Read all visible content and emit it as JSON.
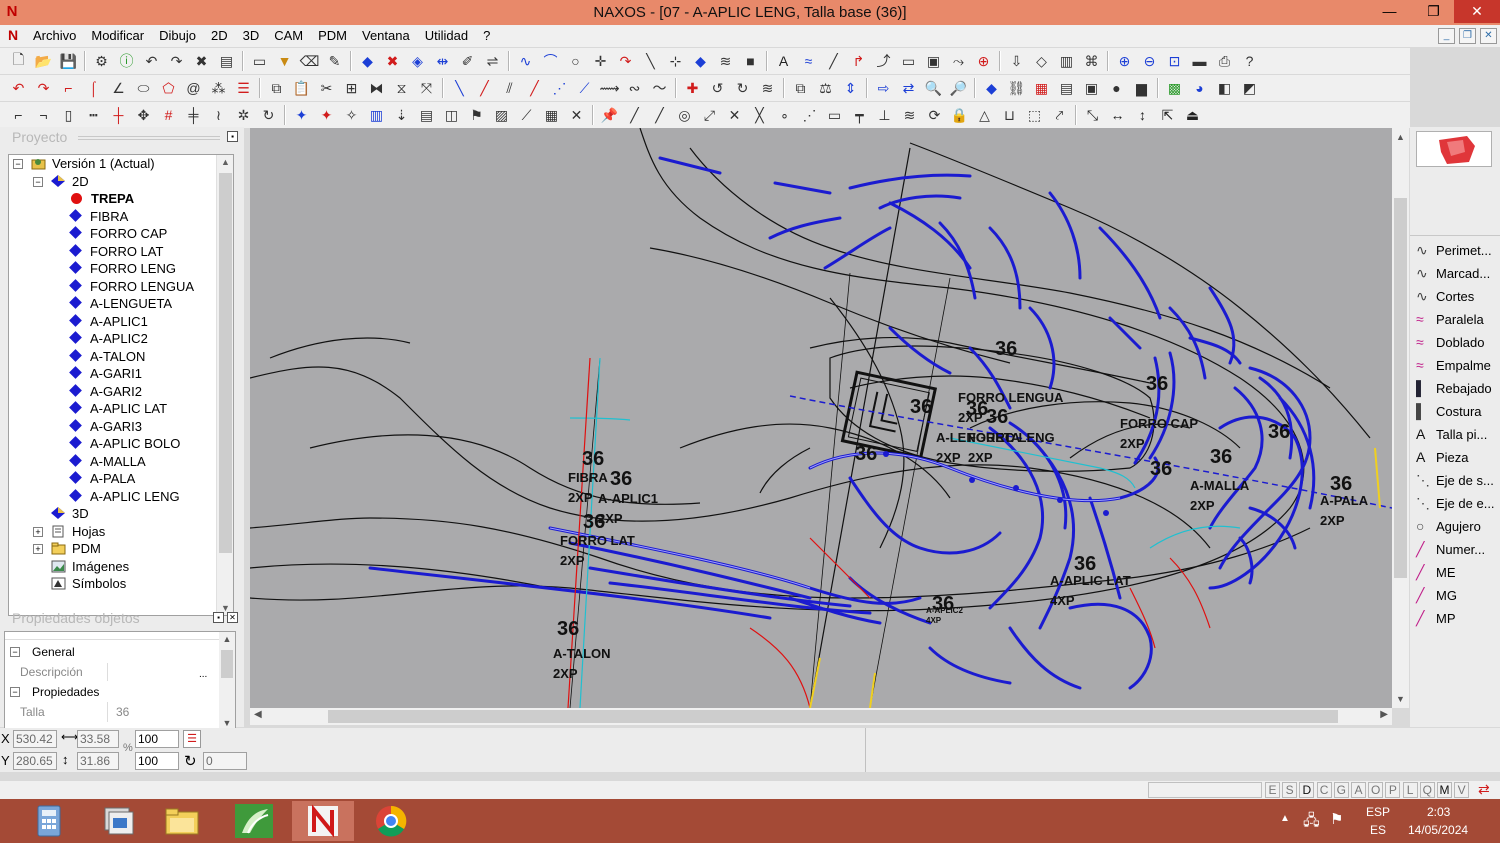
{
  "window": {
    "title": "NAXOS - [07 - A-APLIC LENG, Talla base (36)]",
    "app_logo": "N",
    "controls": [
      "—",
      "❐",
      "✕"
    ]
  },
  "menu": {
    "items": [
      "Archivo",
      "Modificar",
      "Dibujo",
      "2D",
      "3D",
      "CAM",
      "PDM",
      "Ventana",
      "Utilidad",
      "?"
    ]
  },
  "project_panel": {
    "title": "Proyecto",
    "tree": {
      "root": "Versión 1 (Actual)",
      "folder_2d": "2D",
      "pieces": [
        "TREPA",
        "FIBRA",
        "FORRO CAP",
        "FORRO LAT",
        "FORRO LENG",
        "FORRO LENGUA",
        "A-LENGUETA",
        "A-APLIC1",
        "A-APLIC2",
        "A-TALON",
        "A-GARI1",
        "A-GARI2",
        "A-APLIC LAT",
        "A-GARI3",
        "A-APLIC BOLO",
        "A-MALLA",
        "A-PALA",
        "A-APLIC LENG"
      ],
      "active_piece": "TREPA",
      "folder_3d": "3D",
      "hojas": "Hojas",
      "pdm": "PDM",
      "imagenes": "Imágenes",
      "simbolos": "Símbolos"
    }
  },
  "properties_panel": {
    "title": "Propiedades objetos",
    "group_general": "General",
    "descripcion_label": "Descripción",
    "descripcion_value": "",
    "group_propiedades": "Propiedades",
    "talla_label": "Talla",
    "talla_value": "36"
  },
  "coords": {
    "x_label": "X",
    "y_label": "Y",
    "x_value": "530.42",
    "y_value": "280.65",
    "dx_value": "33.58",
    "dy_value": "31.86",
    "scale_x": "100",
    "scale_y": "100",
    "rotation": "0",
    "percent": "%"
  },
  "right_tools": [
    "Perimet...",
    "Marcad...",
    "Cortes",
    "Paralela",
    "Doblado",
    "Empalme",
    "Rebajado",
    "Costura",
    "Talla pi...",
    "Pieza",
    "Eje de s...",
    "Eje de e...",
    "Agujero",
    "Numer...",
    "ME",
    "MG",
    "MP"
  ],
  "right_tool_icons": [
    "curve-icon",
    "curve-icon",
    "curve-icon",
    "parallel-icon",
    "fold-icon",
    "join-icon",
    "skive-icon",
    "stitch-icon",
    "text-icon",
    "text-icon",
    "axis-icon",
    "axis-icon",
    "hole-icon",
    "number-icon",
    "marker-icon",
    "marker-icon",
    "marker-icon"
  ],
  "canvas_labels": {
    "size": "36",
    "pieces": [
      {
        "name": "FORRO LENGUA",
        "qty": "2XP"
      },
      {
        "name": "A-LENGUETA",
        "qty": "2XP"
      },
      {
        "name": "FORRO LENG",
        "qty": "2XP"
      },
      {
        "name": "FORRO CAP",
        "qty": "2XP"
      },
      {
        "name": "FIBRA",
        "qty": "2XP"
      },
      {
        "name": "A-APLIC1",
        "qty": "2XP"
      },
      {
        "name": "FORRO LAT",
        "qty": "2XP"
      },
      {
        "name": "A-MALLA",
        "qty": "2XP"
      },
      {
        "name": "A-PALA",
        "qty": "2XP"
      },
      {
        "name": "A-APLIC LAT",
        "qty": "4XP"
      },
      {
        "name": "A-TALON",
        "qty": "2XP"
      },
      {
        "name": "A-APLIC2",
        "qty": "4XP"
      }
    ]
  },
  "status_flags": [
    "E",
    "S",
    "D",
    "C",
    "G",
    "A",
    "O",
    "P",
    "L",
    "Q",
    "M",
    "V"
  ],
  "tray": {
    "lang_top": "ESP",
    "lang_bottom": "ES",
    "time": "2:03",
    "date": "14/05/2024"
  },
  "colors": {
    "titlebar": "#e8896a",
    "taskbar": "#a44a36",
    "canvas_bg": "#aaaaac",
    "piece_outline": "#1b1bd0",
    "accent_red": "#e01010"
  }
}
